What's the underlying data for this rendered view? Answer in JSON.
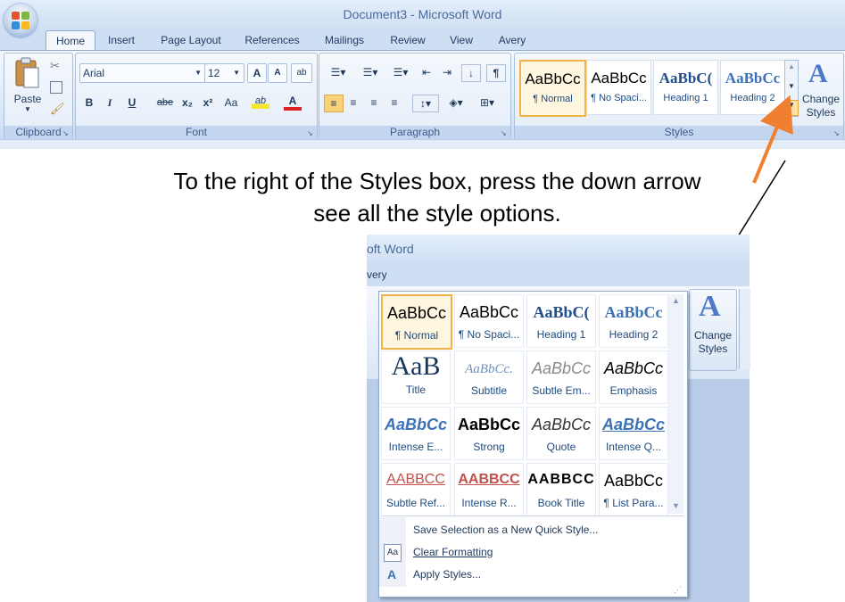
{
  "window": {
    "title": "Document3 - Microsoft Word"
  },
  "tabs": [
    "Home",
    "Insert",
    "Page Layout",
    "References",
    "Mailings",
    "Review",
    "View",
    "Avery"
  ],
  "clipboard": {
    "paste_label": "Paste",
    "group_label": "Clipboard"
  },
  "font": {
    "name": "Arial",
    "size": "12",
    "group_label": "Font",
    "grow": "A",
    "shrink": "A",
    "bold": "B",
    "italic": "I",
    "underline": "U",
    "strike": "abe",
    "sub": "x₂",
    "sup": "x²",
    "case": "Aa",
    "highlight": "ab",
    "color": "A"
  },
  "paragraph": {
    "group_label": "Paragraph",
    "pilcrow": "¶"
  },
  "styles": {
    "group_label": "Styles",
    "quick": [
      {
        "sample": "AaBbCc",
        "label": "¶ Normal",
        "selected": true
      },
      {
        "sample": "AaBbCc",
        "label": "¶ No Spaci...",
        "selected": false
      },
      {
        "sample": "AaBbC(",
        "label": "Heading 1",
        "selected": false
      },
      {
        "sample": "AaBbCc",
        "label": "Heading 2",
        "selected": false
      }
    ],
    "change_styles_line1": "Change",
    "change_styles_line2": "Styles"
  },
  "instruction": {
    "line1": "To the right of the Styles box, press the down arrow",
    "line2": "see all the style options."
  },
  "zoom": {
    "title_fragment": "oft Word",
    "tab_fragment": "very",
    "change_styles_line1": "Change",
    "change_styles_line2": "Styles"
  },
  "gallery": {
    "styles": [
      {
        "sample": "AaBbCc",
        "label": "¶ Normal",
        "selected": true
      },
      {
        "sample": "AaBbCc",
        "label": "¶ No Spaci...",
        "selected": false
      },
      {
        "sample": "AaBbC(",
        "label": "Heading 1",
        "selected": false
      },
      {
        "sample": "AaBbCc",
        "label": "Heading 2",
        "selected": false
      },
      {
        "sample": "AaB",
        "label": "Title",
        "selected": false
      },
      {
        "sample": "AaBbCc.",
        "label": "Subtitle",
        "selected": false
      },
      {
        "sample": "AaBbCc",
        "label": "Subtle Em...",
        "selected": false
      },
      {
        "sample": "AaBbCc",
        "label": "Emphasis",
        "selected": false
      },
      {
        "sample": "AaBbCc",
        "label": "Intense E...",
        "selected": false
      },
      {
        "sample": "AaBbCc",
        "label": "Strong",
        "selected": false
      },
      {
        "sample": "AaBbCc",
        "label": "Quote",
        "selected": false
      },
      {
        "sample": "AaBbCc",
        "label": "Intense Q...",
        "selected": false
      },
      {
        "sample": "AABBCC",
        "label": "Subtle Ref...",
        "selected": false
      },
      {
        "sample": "AABBCC",
        "label": "Intense R...",
        "selected": false
      },
      {
        "sample": "AABBCC",
        "label": "Book Title",
        "selected": false
      },
      {
        "sample": "AaBbCc",
        "label": "¶ List Para...",
        "selected": false
      }
    ],
    "menu": [
      "Save Selection as a New Quick Style...",
      "Clear Formatting",
      "Apply Styles..."
    ]
  },
  "colors": {
    "accent_orange": "#f08030",
    "ribbon_blue": "#c9dbf1",
    "selected_border": "#f0b34a"
  }
}
